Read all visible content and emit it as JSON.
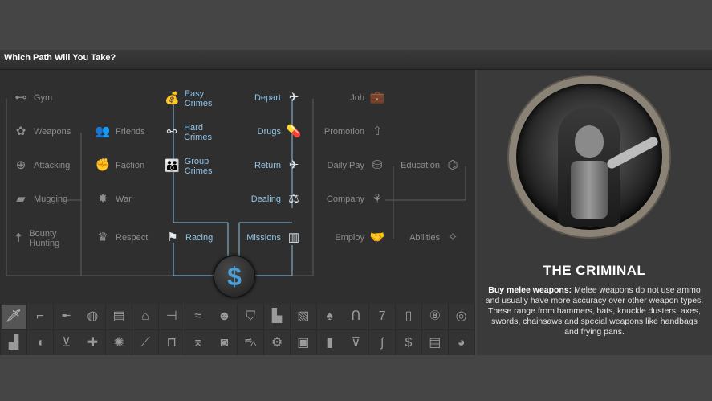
{
  "header": {
    "title": "Which Path Will You Take?"
  },
  "tree": {
    "col1": [
      {
        "label": "Gym",
        "icon": "dumbbell-icon"
      },
      {
        "label": "Weapons",
        "icon": "flower-icon"
      },
      {
        "label": "Attacking",
        "icon": "crosshair-icon"
      },
      {
        "label": "Mugging",
        "icon": "wallet-icon"
      },
      {
        "label": "Bounty Hunting",
        "icon": "gunman-icon"
      }
    ],
    "col2": [
      {
        "label": "Friends",
        "icon": "people-icon"
      },
      {
        "label": "Faction",
        "icon": "fist-icon"
      },
      {
        "label": "War",
        "icon": "explosion-icon"
      },
      {
        "label": "Respect",
        "icon": "crown-icon"
      }
    ],
    "col3": [
      {
        "label": "Easy Crimes",
        "icon": "money-bag-icon"
      },
      {
        "label": "Hard Crimes",
        "icon": "handcuffs-icon"
      },
      {
        "label": "Group Crimes",
        "icon": "group-icon"
      },
      {
        "label": "Racing",
        "icon": "checkered-flag-icon"
      }
    ],
    "col4": [
      {
        "label": "Depart",
        "icon": "plane-icon"
      },
      {
        "label": "Drugs",
        "icon": "pill-icon"
      },
      {
        "label": "Return",
        "icon": "plane-return-icon"
      },
      {
        "label": "Dealing",
        "icon": "scales-icon"
      },
      {
        "label": "Missions",
        "icon": "map-icon"
      }
    ],
    "col5": [
      {
        "label": "Job",
        "icon": "briefcase-icon"
      },
      {
        "label": "Promotion",
        "icon": "arrow-up-icon"
      },
      {
        "label": "Daily Pay",
        "icon": "coins-icon"
      },
      {
        "label": "Company",
        "icon": "plant-icon"
      },
      {
        "label": "Employ",
        "icon": "handshake-icon"
      }
    ],
    "col6": [
      {
        "label": "Education",
        "icon": "pill-capsule-icon"
      },
      {
        "label": "Abilities",
        "icon": "wand-icon"
      }
    ],
    "center": {
      "label": "$",
      "icon": "dollar-icon"
    }
  },
  "weapon_icons": {
    "row1": [
      "knife-icon",
      "pistol-icon",
      "rifle-icon",
      "grenade-icon",
      "id-card-icon",
      "house-icon",
      "signpost-icon",
      "swimmer-icon",
      "person-icon",
      "shield-icon",
      "factory-icon",
      "cards-icon",
      "spade-icon",
      "horseshoe-icon",
      "seven-icon",
      "trash-icon",
      "ball-8-icon",
      "chip-icon"
    ],
    "row2": [
      "chart-icon",
      "pig-icon",
      "cart-icon",
      "medkit-icon",
      "virus-icon",
      "syringe-icon",
      "lock-open-icon",
      "graduation-cap-icon",
      "camera-icon",
      "car-icon",
      "gear-icon",
      "suitcase-icon",
      "bottle-icon",
      "glass-icon",
      "candy-cane-icon",
      "coin-icon",
      "document-icon",
      "palette-icon"
    ],
    "selected_index": 0
  },
  "profile": {
    "role": "THE CRIMINAL",
    "lead": "Buy melee weapons:",
    "description": "Melee weapons do not use ammo and usually have more accuracy over other weapon types. These range from hammers, bats, knuckle dusters, axes, swords, chainsaws and special weapons like handbags and frying pans."
  }
}
